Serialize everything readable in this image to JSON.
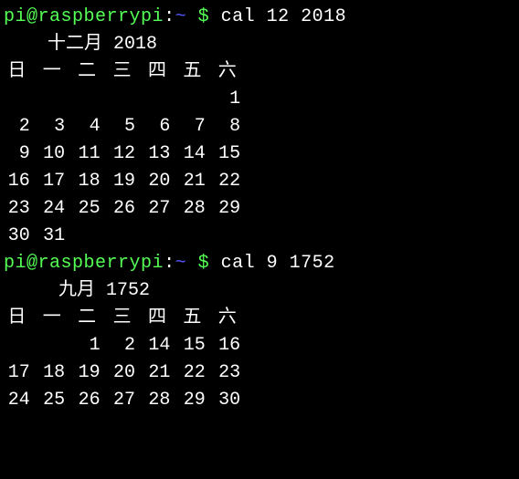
{
  "prompt1": {
    "user": "pi",
    "at": "@",
    "host": "raspberrypi",
    "colon": ":",
    "path": "~",
    "dollar": " $ ",
    "command": "cal 12 2018"
  },
  "cal1": {
    "title": "    十二月 2018",
    "headers": [
      "日",
      "一",
      "二",
      "三",
      "四",
      "五",
      "六"
    ],
    "rows": [
      [
        "",
        "",
        "",
        "",
        "",
        "",
        "1"
      ],
      [
        "2",
        "3",
        "4",
        "5",
        "6",
        "7",
        "8"
      ],
      [
        "9",
        "10",
        "11",
        "12",
        "13",
        "14",
        "15"
      ],
      [
        "16",
        "17",
        "18",
        "19",
        "20",
        "21",
        "22"
      ],
      [
        "23",
        "24",
        "25",
        "26",
        "27",
        "28",
        "29"
      ],
      [
        "30",
        "31",
        "",
        "",
        "",
        "",
        ""
      ]
    ]
  },
  "prompt2": {
    "user": "pi",
    "at": "@",
    "host": "raspberrypi",
    "colon": ":",
    "path": "~",
    "dollar": " $ ",
    "command": "cal 9 1752"
  },
  "cal2": {
    "title": "     九月 1752",
    "headers": [
      "日",
      "一",
      "二",
      "三",
      "四",
      "五",
      "六"
    ],
    "rows": [
      [
        "",
        "",
        "1",
        "2",
        "14",
        "15",
        "16"
      ],
      [
        "17",
        "18",
        "19",
        "20",
        "21",
        "22",
        "23"
      ],
      [
        "24",
        "25",
        "26",
        "27",
        "28",
        "29",
        "30"
      ]
    ]
  }
}
